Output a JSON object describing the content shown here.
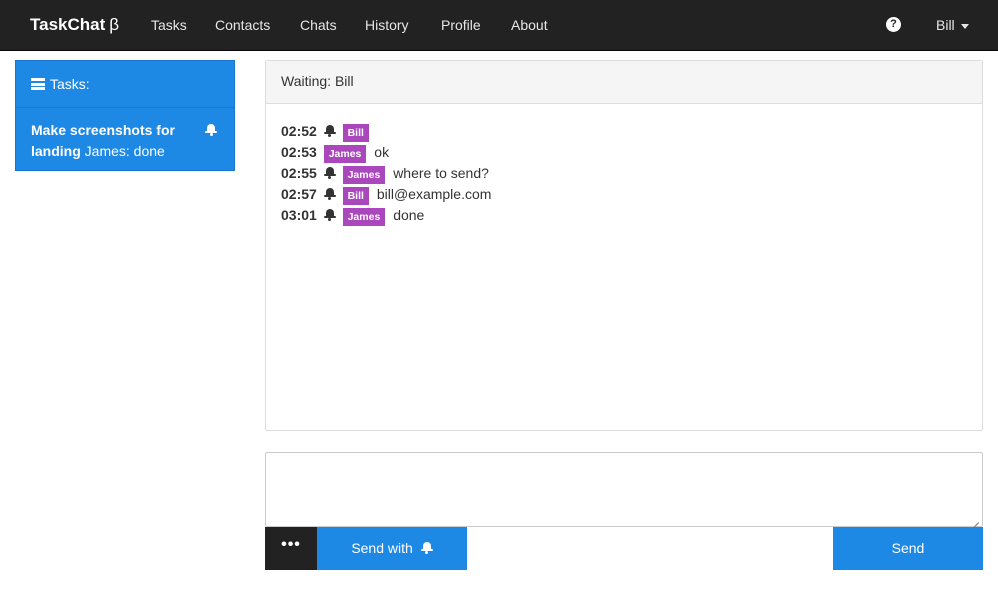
{
  "navbar": {
    "brand": "TaskChat",
    "brand_suffix": "β",
    "items": [
      {
        "label": "Tasks"
      },
      {
        "label": "Contacts"
      },
      {
        "label": "Chats"
      },
      {
        "label": "History"
      },
      {
        "label": "Profile"
      },
      {
        "label": "About"
      }
    ],
    "help_icon": "question-circle-icon",
    "user": "Bill"
  },
  "sidebar": {
    "header_label": "Tasks:",
    "tasks": [
      {
        "title": "Make screenshots for landing",
        "status": "James: done",
        "icon": "bell-icon"
      }
    ]
  },
  "chat": {
    "heading": "Waiting: Bill",
    "messages": [
      {
        "time": "02:52",
        "bell": true,
        "author": "Bill",
        "text": ""
      },
      {
        "time": "02:53",
        "bell": false,
        "author": "James",
        "text": "ok"
      },
      {
        "time": "02:55",
        "bell": true,
        "author": "James",
        "text": "where to send?"
      },
      {
        "time": "02:57",
        "bell": true,
        "author": "Bill",
        "text": "bill@example.com"
      },
      {
        "time": "03:01",
        "bell": true,
        "author": "James",
        "text": "done"
      }
    ]
  },
  "composer": {
    "value": "",
    "more_label": "•••",
    "send_with_label": "Send with",
    "send_label": "Send"
  },
  "colors": {
    "navbar_bg": "#222222",
    "primary": "#1e88e5",
    "author_badge": "#ab47bc"
  }
}
